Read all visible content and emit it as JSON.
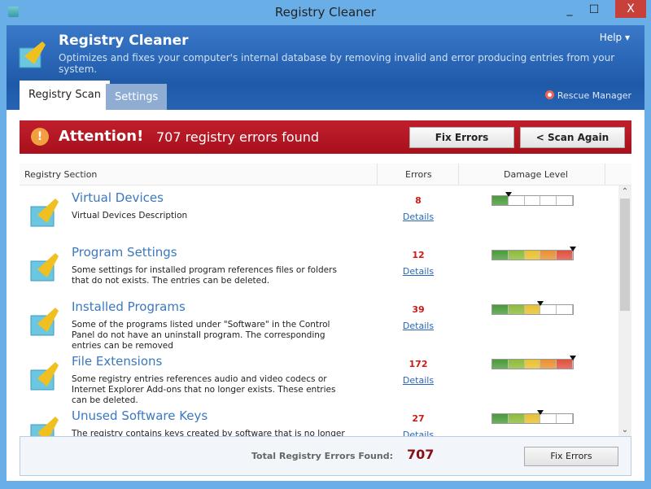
{
  "window": {
    "title": "Registry Cleaner",
    "minimize": "_",
    "maximize": "☐",
    "close": "X"
  },
  "header": {
    "title": "Registry Cleaner",
    "subtitle": "Optimizes and fixes your computer's internal database by removing invalid and error producing entries from your system.",
    "help": "Help ▾",
    "rescue": "Rescue Manager"
  },
  "tabs": [
    {
      "label": "Registry Scan",
      "active": true
    },
    {
      "label": "Settings",
      "active": false
    }
  ],
  "alert": {
    "title": "Attention!",
    "message": "707 registry errors found",
    "fix": "Fix Errors",
    "scan": "< Scan Again",
    "icon": "!"
  },
  "table": {
    "headers": [
      "Registry Section",
      "Errors",
      "Damage Level"
    ],
    "details_label": "Details",
    "rows": [
      {
        "name": "Virtual Devices",
        "desc": "Virtual Devices Description",
        "errors": "8",
        "damage_level": 1,
        "damage_max": 5
      },
      {
        "name": "Program Settings",
        "desc": "Some settings for installed program references files or folders that do not exists. The entries can be deleted.",
        "errors": "12",
        "damage_level": 5,
        "damage_max": 5
      },
      {
        "name": "Installed Programs",
        "desc": "Some of the programs listed under \"Software\" in the Control Panel do not have an uninstall program. The corresponding entries can be removed",
        "errors": "39",
        "damage_level": 3,
        "damage_max": 5
      },
      {
        "name": "File Extensions",
        "desc": "Some registry entries references audio and video codecs or Internet Explorer Add-ons that no longer exists. These entries can be deleted.",
        "errors": "172",
        "damage_level": 5,
        "damage_max": 5
      },
      {
        "name": "Unused Software Keys",
        "desc": "The registry contains keys created by software that is no longer installed.",
        "errors": "27",
        "damage_level": 3,
        "damage_max": 5
      }
    ]
  },
  "footer": {
    "label": "Total Registry Errors Found:",
    "total": "707",
    "fix": "Fix Errors"
  },
  "colors": {
    "accent": "#1f5aa8",
    "alert": "#b5141f",
    "meter": [
      "#4a9a3a",
      "#8cbb3a",
      "#e8c030",
      "#e89030",
      "#e05040"
    ]
  }
}
